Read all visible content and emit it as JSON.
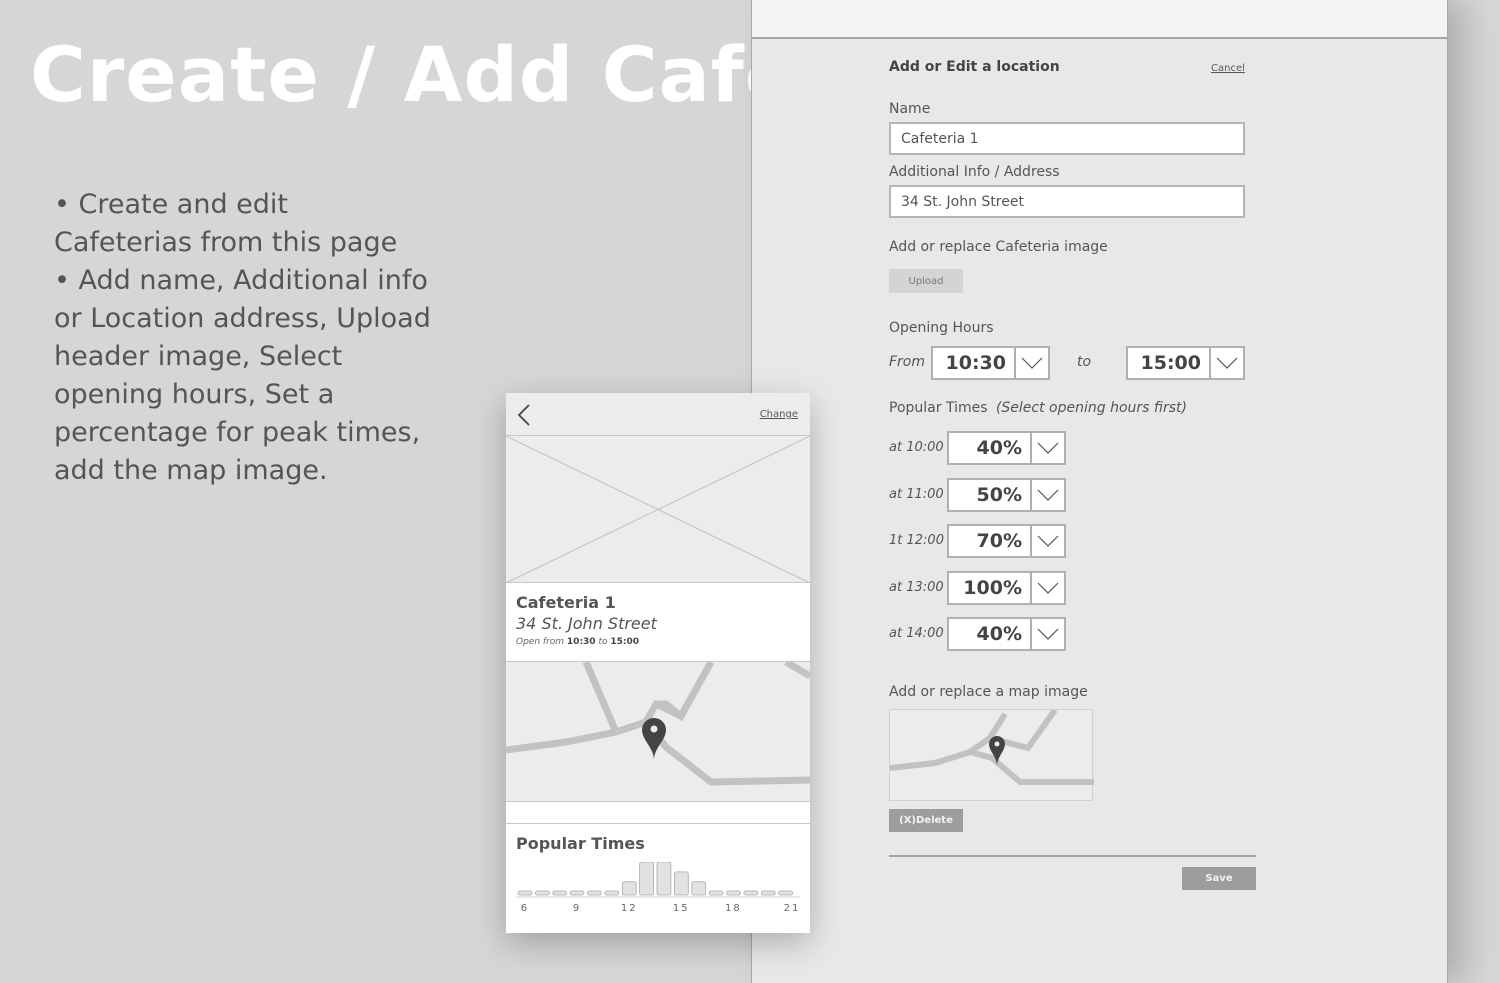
{
  "hero": {
    "title": "Create / Add Cafeteria",
    "bullets": [
      "• Create and edit Cafeterias from this page",
      "• Add name, Additional info or Location address, Upload header image, Select opening hours, Set a percentage for peak times, add the map image."
    ]
  },
  "form": {
    "title": "Add or Edit a location",
    "cancel_label": "Cancel",
    "name_label": "Name",
    "name_value": "Cafeteria 1",
    "address_label": "Additional Info / Address",
    "address_value": "34 St. John Street",
    "image_label": "Add or replace Cafeteria image",
    "upload_label": "Upload",
    "hours_label": "Opening Hours",
    "from_label": "From",
    "from_value": "10:30",
    "to_label": "to",
    "to_value": "15:00",
    "popular_label": "Popular Times",
    "popular_hint": "(Select opening hours first)",
    "popular_rows": [
      {
        "label": "at 10:00",
        "value": "40%"
      },
      {
        "label": "at 11:00",
        "value": "50%"
      },
      {
        "label": "1t 12:00",
        "value": "70%"
      },
      {
        "label": "at 13:00",
        "value": "100%"
      },
      {
        "label": "at 14:00",
        "value": "40%"
      }
    ],
    "map_label": "Add or replace a map image",
    "delete_label": "(X)Delete",
    "save_label": "Save"
  },
  "phone": {
    "change_label": "Change",
    "cafeteria_name": "Cafeteria 1",
    "cafeteria_address": "34 St. John Street",
    "open_prefix": "Open from",
    "open_from": "10:30",
    "open_to_word": "to",
    "open_to": "15:00",
    "popular_title": "Popular Times"
  },
  "chart_data": {
    "type": "bar",
    "categories": [
      "6",
      "7",
      "8",
      "9",
      "10",
      "11",
      "12",
      "13",
      "14",
      "15",
      "16",
      "17",
      "18",
      "19",
      "20",
      "21"
    ],
    "values": [
      0,
      0,
      0,
      0,
      0,
      10,
      40,
      100,
      100,
      70,
      40,
      0,
      0,
      0,
      0,
      0
    ],
    "tick_labels": [
      "6",
      "9",
      "12",
      "15",
      "18",
      "21"
    ],
    "ylim": [
      0,
      100
    ],
    "colors": {
      "bar": "#e2e2e2",
      "stroke": "#a8a8a8"
    }
  }
}
